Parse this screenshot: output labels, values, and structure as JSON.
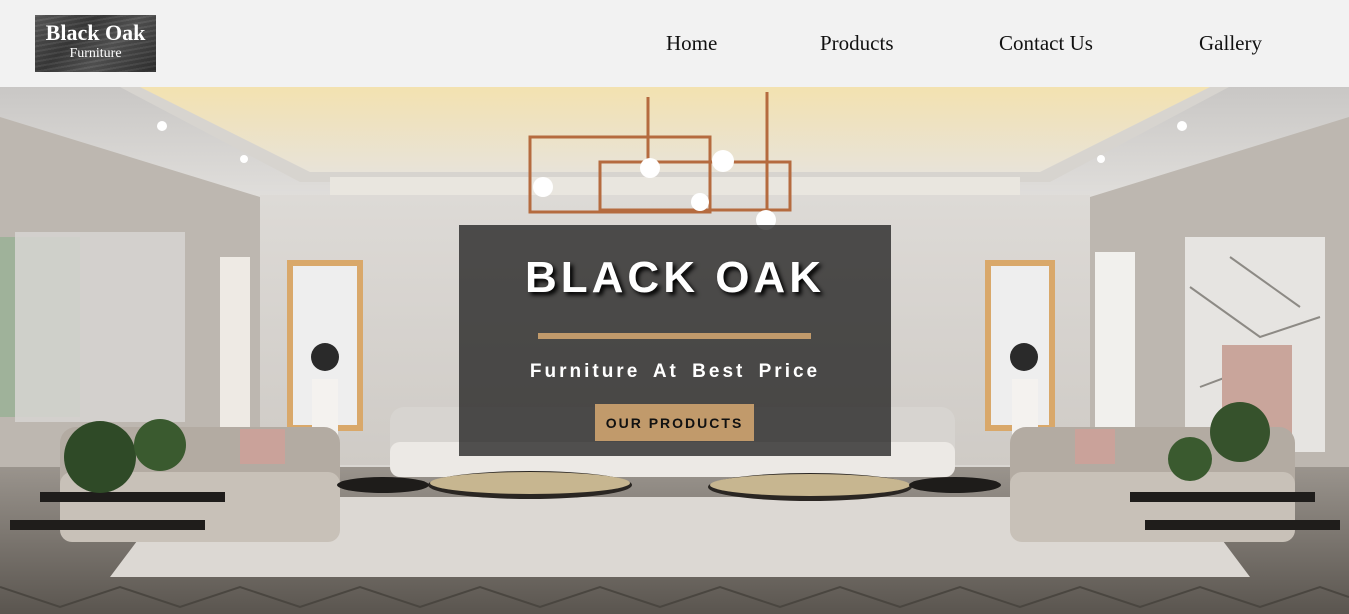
{
  "logo": {
    "title": "Black Oak",
    "subtitle": "Furniture"
  },
  "nav": {
    "home": "Home",
    "products": "Products",
    "contact": "Contact Us",
    "gallery": "Gallery"
  },
  "hero": {
    "title": "BLACK OAK",
    "subtitle": "Furniture At Best Price",
    "button_label": "OUR PRODUCTS"
  },
  "colors": {
    "header_bg": "#f2f2f2",
    "accent": "#c19a6b",
    "overlay": "#141414"
  }
}
